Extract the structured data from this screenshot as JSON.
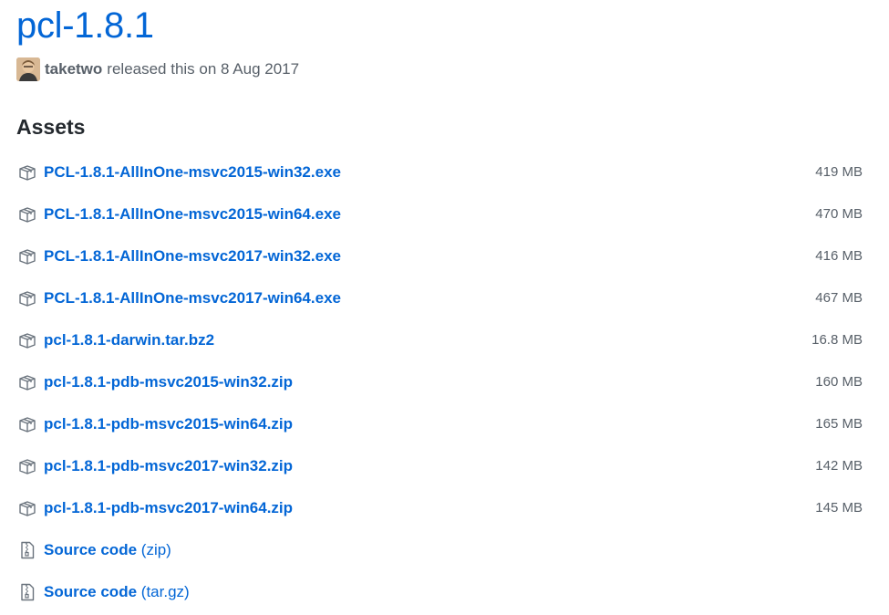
{
  "release": {
    "title": "pcl-1.8.1",
    "author": "taketwo",
    "released_text": "released this on 8 Aug 2017"
  },
  "assets": {
    "heading": "Assets",
    "files": [
      {
        "name": "PCL-1.8.1-AllInOne-msvc2015-win32.exe",
        "size": "419 MB",
        "icon": "package-icon"
      },
      {
        "name": "PCL-1.8.1-AllInOne-msvc2015-win64.exe",
        "size": "470 MB",
        "icon": "package-icon"
      },
      {
        "name": "PCL-1.8.1-AllInOne-msvc2017-win32.exe",
        "size": "416 MB",
        "icon": "package-icon"
      },
      {
        "name": "PCL-1.8.1-AllInOne-msvc2017-win64.exe",
        "size": "467 MB",
        "icon": "package-icon"
      },
      {
        "name": "pcl-1.8.1-darwin.tar.bz2",
        "size": "16.8 MB",
        "icon": "package-icon"
      },
      {
        "name": "pcl-1.8.1-pdb-msvc2015-win32.zip",
        "size": "160 MB",
        "icon": "package-icon"
      },
      {
        "name": "pcl-1.8.1-pdb-msvc2015-win64.zip",
        "size": "165 MB",
        "icon": "package-icon"
      },
      {
        "name": "pcl-1.8.1-pdb-msvc2017-win32.zip",
        "size": "142 MB",
        "icon": "package-icon"
      },
      {
        "name": "pcl-1.8.1-pdb-msvc2017-win64.zip",
        "size": "145 MB",
        "icon": "package-icon"
      }
    ],
    "source": [
      {
        "label": "Source code",
        "format": "(zip)",
        "icon": "file-zip-icon"
      },
      {
        "label": "Source code",
        "format": "(tar.gz)",
        "icon": "file-zip-icon"
      }
    ]
  },
  "colors": {
    "link": "#0366d6",
    "muted": "#586069",
    "text": "#24292e"
  }
}
